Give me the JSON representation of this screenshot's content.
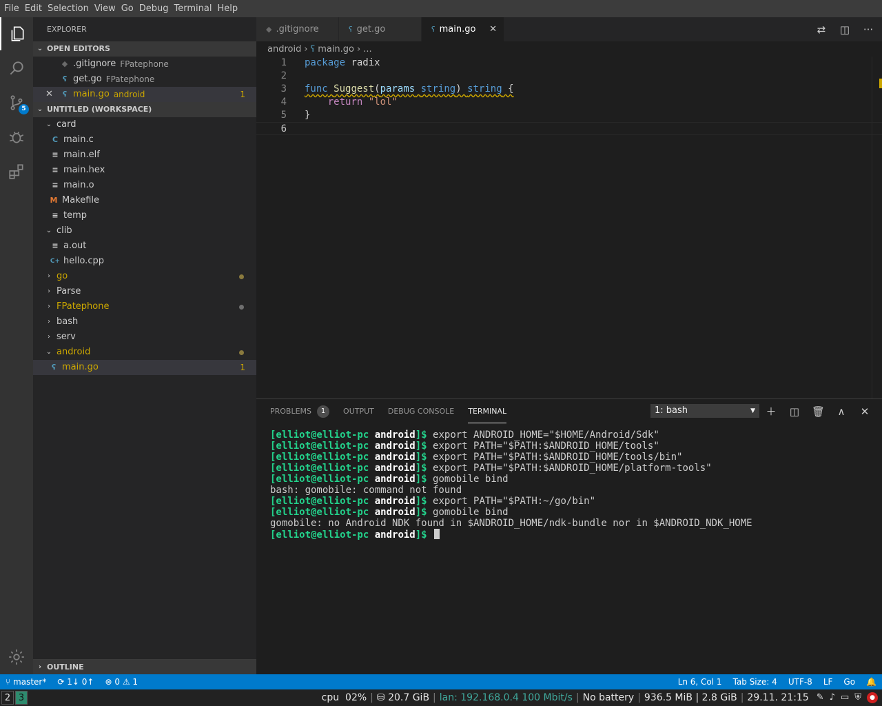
{
  "menu": [
    "File",
    "Edit",
    "Selection",
    "View",
    "Go",
    "Debug",
    "Terminal",
    "Help"
  ],
  "activity": {
    "scm_badge": "5"
  },
  "sidebar": {
    "title": "EXPLORER",
    "open_editors": {
      "title": "OPEN EDITORS",
      "items": [
        {
          "name": ".gitignore",
          "desc": "FPatephone"
        },
        {
          "name": "get.go",
          "desc": "FPatephone"
        },
        {
          "name": "main.go",
          "desc": "android",
          "count": "1"
        }
      ]
    },
    "workspace": {
      "title": "UNTITLED (WORKSPACE)",
      "tree": [
        {
          "label": "card"
        },
        {
          "label": "main.c",
          "icon": "C"
        },
        {
          "label": "main.elf"
        },
        {
          "label": "main.hex"
        },
        {
          "label": "main.o"
        },
        {
          "label": "Makefile",
          "icon": "M"
        },
        {
          "label": "temp"
        },
        {
          "label": "clib"
        },
        {
          "label": "a.out"
        },
        {
          "label": "hello.cpp",
          "icon": "C+"
        },
        {
          "label": "go"
        },
        {
          "label": "Parse"
        },
        {
          "label": "FPatephone"
        },
        {
          "label": "bash"
        },
        {
          "label": "serv"
        },
        {
          "label": "android"
        },
        {
          "label": "main.go",
          "count": "1"
        }
      ]
    },
    "outline": "OUTLINE"
  },
  "tabs": [
    {
      "label": ".gitignore"
    },
    {
      "label": "get.go"
    },
    {
      "label": "main.go"
    }
  ],
  "breadcrumb": {
    "folder": "android",
    "file": "main.go",
    "more": "..."
  },
  "editor": {
    "line_numbers": [
      "1",
      "2",
      "3",
      "4",
      "5",
      "6"
    ],
    "tokens": {
      "l1a": "package",
      "l1b": " radix",
      "l3a": "func",
      "l3b": " ",
      "l3c": "Suggest",
      "l3d": "(",
      "l3e": "params",
      "l3f": " ",
      "l3g": "string",
      "l3h": ") ",
      "l3i": "string",
      "l3j": " {",
      "l4a": "    ",
      "l4b": "return",
      "l4c": " ",
      "l4d": "\"lol\"",
      "l5a": "}"
    }
  },
  "panel": {
    "tabs": {
      "problems": "PROBLEMS",
      "problems_count": "1",
      "output": "OUTPUT",
      "debug": "DEBUG CONSOLE",
      "terminal": "TERMINAL"
    },
    "terminal_select": "1: bash",
    "prompt_user": "[elliot@elliot-pc",
    "prompt_dir": "android",
    "prompt_end": "]$",
    "lines": [
      {
        "cmd": " export ANDROID_HOME=\"$HOME/Android/Sdk\""
      },
      {
        "cmd": " export PATH=\"$PATH:$ANDROID_HOME/tools\""
      },
      {
        "cmd": " export PATH=\"$PATH:$ANDROID_HOME/tools/bin\""
      },
      {
        "cmd": " export PATH=\"$PATH:$ANDROID_HOME/platform-tools\""
      },
      {
        "cmd": " gomobile bind"
      },
      {
        "out": "bash: gomobile: command not found"
      },
      {
        "cmd": " export PATH=\"$PATH:~/go/bin\""
      },
      {
        "cmd": " gomobile bind"
      },
      {
        "out": "gomobile: no Android NDK found in $ANDROID_HOME/ndk-bundle nor in $ANDROID_NDK_HOME"
      },
      {
        "cmd": " "
      }
    ]
  },
  "status": {
    "branch": "master*",
    "sync": "1↓ 0↑",
    "errors": "0",
    "warnings": "1",
    "position": "Ln 6, Col 1",
    "tab_size": "Tab Size: 4",
    "encoding": "UTF-8",
    "eol": "LF",
    "language": "Go"
  },
  "os": {
    "workspaces": [
      "2",
      "3"
    ],
    "cpu_label": "cpu",
    "cpu_value": "02%",
    "disk": "20.7 GiB",
    "lan": "lan: 192.168.0.4 100 Mbit/s",
    "battery": "No battery",
    "memory": "936.5 MiB | 2.8 GiB",
    "datetime": "29.11. 21:15"
  },
  "colors": {
    "accent": "#007acc",
    "warning": "#cca700",
    "prompt": "#23d18b",
    "lan": "#3fa89c"
  }
}
